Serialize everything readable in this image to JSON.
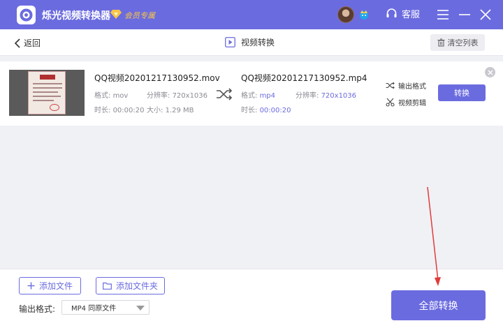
{
  "app": {
    "title": "烁光视频转换器",
    "vip_label": "会员专属",
    "service_label": "客服"
  },
  "nav": {
    "back_label": "返回",
    "title": "视频转换",
    "clear_label": "清空列表"
  },
  "file": {
    "source": {
      "name": "QQ视频20201217130952.mov",
      "format_label": "格式:",
      "format": "mov",
      "resolution_label": "分辨率:",
      "resolution": "720x1036",
      "duration_label": "时长:",
      "duration": "00:00:20",
      "size_label": "大小:",
      "size": "1.29 MB"
    },
    "output": {
      "name": "QQ视频20201217130952.mp4",
      "format_label": "格式:",
      "format": "mp4",
      "resolution_label": "分辨率:",
      "resolution": "720x1036",
      "duration_label": "时长:",
      "duration": "00:00:20"
    },
    "output_format_label": "输出格式",
    "edit_label": "视频剪辑",
    "convert_label": "转换"
  },
  "bottom": {
    "add_file_label": "添加文件",
    "add_folder_label": "添加文件夹",
    "format_label": "输出格式:",
    "format_value": "MP4 同原文件",
    "convert_all_label": "全部转换"
  },
  "colors": {
    "accent": "#6b6be0",
    "vip": "#f7c546",
    "annotation_arrow": "#e23b3b"
  }
}
